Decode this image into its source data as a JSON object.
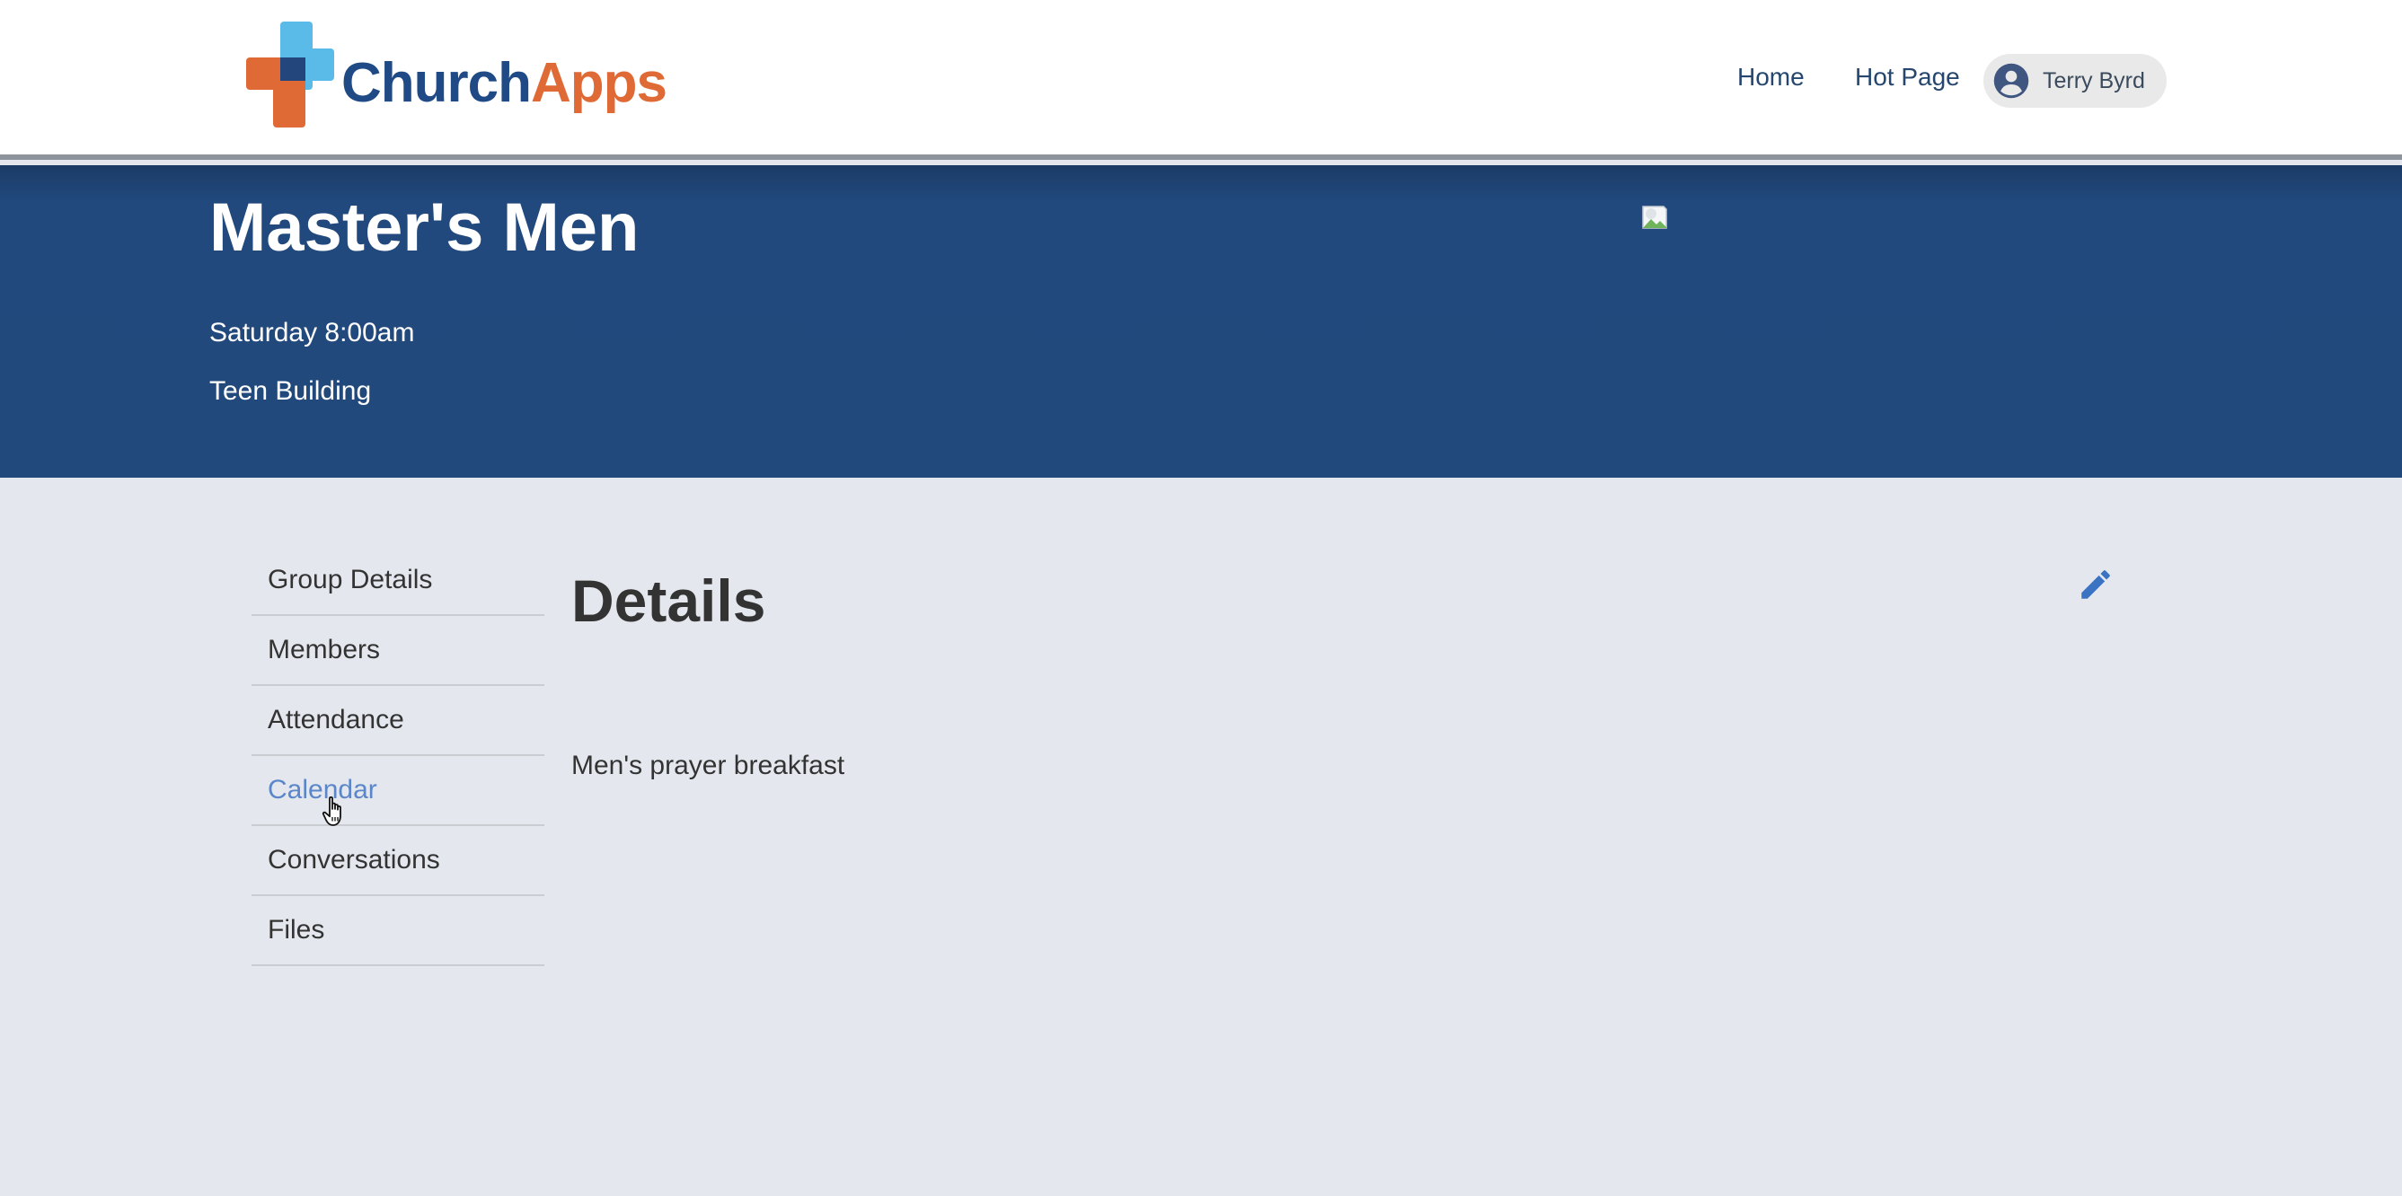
{
  "brand": {
    "logo_church": "Church",
    "logo_apps": "Apps",
    "colors": {
      "blue": "#1f4a85",
      "orange": "#e06a35",
      "light_blue": "#5bbbe8"
    }
  },
  "nav": {
    "home_label": "Home",
    "hot_page_label": "Hot Page",
    "user_name": "Terry Byrd",
    "user_icon": "account-circle-icon"
  },
  "group": {
    "title": "Master's Men",
    "schedule": "Saturday 8:00am",
    "location": "Teen Building",
    "image_icon": "broken-image-icon"
  },
  "sidemenu": {
    "items": [
      {
        "label": "Group Details",
        "active": false
      },
      {
        "label": "Members",
        "active": false
      },
      {
        "label": "Attendance",
        "active": false
      },
      {
        "label": "Calendar",
        "active": true
      },
      {
        "label": "Conversations",
        "active": false
      },
      {
        "label": "Files",
        "active": false
      }
    ]
  },
  "details": {
    "title": "Details",
    "description": "Men's prayer breakfast",
    "edit_icon": "pencil-icon"
  },
  "colors": {
    "hero_bg": "#21497c",
    "page_bg": "#e4e8ee",
    "active_link": "#5b86c9",
    "edit_icon": "#3a72c4"
  }
}
